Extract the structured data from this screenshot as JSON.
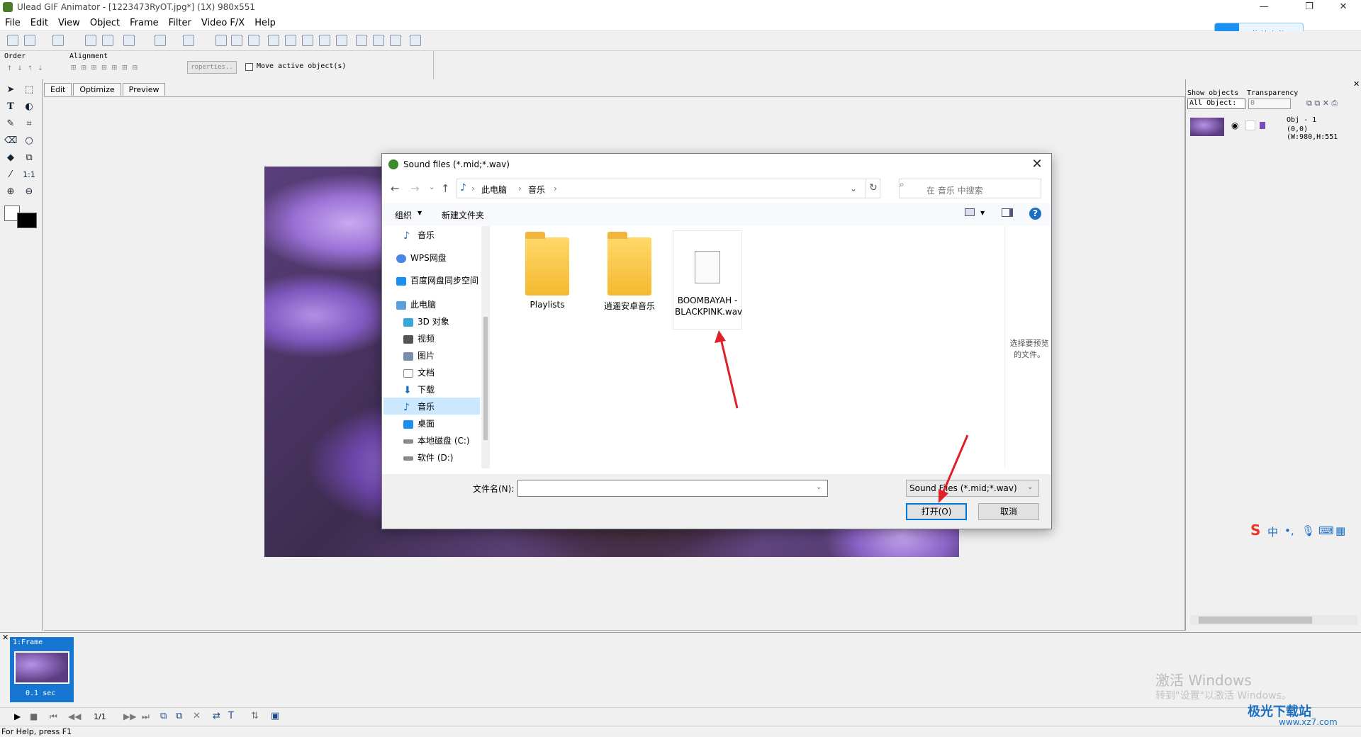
{
  "window": {
    "title": "Ulead GIF Animator - [1223473RyOT.jpg*] (1X) 980x551"
  },
  "menu": [
    "File",
    "Edit",
    "View",
    "Object",
    "Frame",
    "Filter",
    "Video F/X",
    "Help"
  ],
  "upload_button": {
    "label": "拖拽上传"
  },
  "toolbar2": {
    "order_label": "Order",
    "alignment_label": "Alignment",
    "properties_label": "roperties..",
    "move_active_label": "Move active object(s)"
  },
  "workspace_tabs": [
    "Edit",
    "Optimize",
    "Preview"
  ],
  "dialog": {
    "title": "Sound files (*.mid;*.wav)",
    "breadcrumb": [
      "此电脑",
      "音乐"
    ],
    "search_placeholder": "在 音乐 中搜索",
    "organize_label": "组织",
    "new_folder_label": "新建文件夹",
    "nav_items": [
      {
        "label": "音乐",
        "icon": "music-icon",
        "selected": false
      },
      {
        "label": "WPS网盘",
        "icon": "cloud-icon",
        "selected": false
      },
      {
        "label": "百度网盘同步空间",
        "icon": "baidu-cloud-icon",
        "selected": false
      },
      {
        "label": "此电脑",
        "icon": "computer-icon",
        "selected": false
      },
      {
        "label": "3D 对象",
        "icon": "cube-icon",
        "selected": false
      },
      {
        "label": "视频",
        "icon": "video-icon",
        "selected": false
      },
      {
        "label": "图片",
        "icon": "picture-icon",
        "selected": false
      },
      {
        "label": "文档",
        "icon": "document-icon",
        "selected": false
      },
      {
        "label": "下载",
        "icon": "download-icon",
        "selected": false
      },
      {
        "label": "音乐",
        "icon": "music-icon",
        "selected": true
      },
      {
        "label": "桌面",
        "icon": "desktop-icon",
        "selected": false
      },
      {
        "label": "本地磁盘 (C:)",
        "icon": "drive-icon",
        "selected": false
      },
      {
        "label": "软件 (D:)",
        "icon": "drive-icon",
        "selected": false
      }
    ],
    "files": [
      {
        "name": "Playlists",
        "type": "folder"
      },
      {
        "name": "逍遥安卓音乐",
        "type": "folder"
      },
      {
        "name": "BOOMBAYAH - BLACKPINK.wav",
        "type": "file"
      }
    ],
    "preview_hint": "选择要预览的文件。",
    "filename_label": "文件名(N):",
    "filename_value": "",
    "filetype_value": "Sound Files (*.mid;*.wav)",
    "open_label": "打开(O)",
    "cancel_label": "取消"
  },
  "right_panel": {
    "show_objects_label": "Show objects",
    "transparency_label": "Transparency",
    "filter_value": "All Object:",
    "transparency_value": "0",
    "object_name": "Obj - 1",
    "object_info": "(0,0)(W:980,H:551"
  },
  "frame_panel": {
    "frame_label": "1:Frame",
    "frame_duration": "0.1 sec",
    "frame_counter": "1/1"
  },
  "status": {
    "text": "For Help, press F1"
  },
  "watermark": {
    "line1": "激活 Windows",
    "line2": "转到\"设置\"以激活 Windows。"
  },
  "brand": {
    "name": "极光下载站",
    "url": "www.xz7.com"
  },
  "ime": {
    "lang": "中"
  },
  "colors": {
    "accent": "#0078d7",
    "selection": "#cce8ff",
    "frame_selected": "#1676d2",
    "annotation_arrow": "#e0202a"
  }
}
